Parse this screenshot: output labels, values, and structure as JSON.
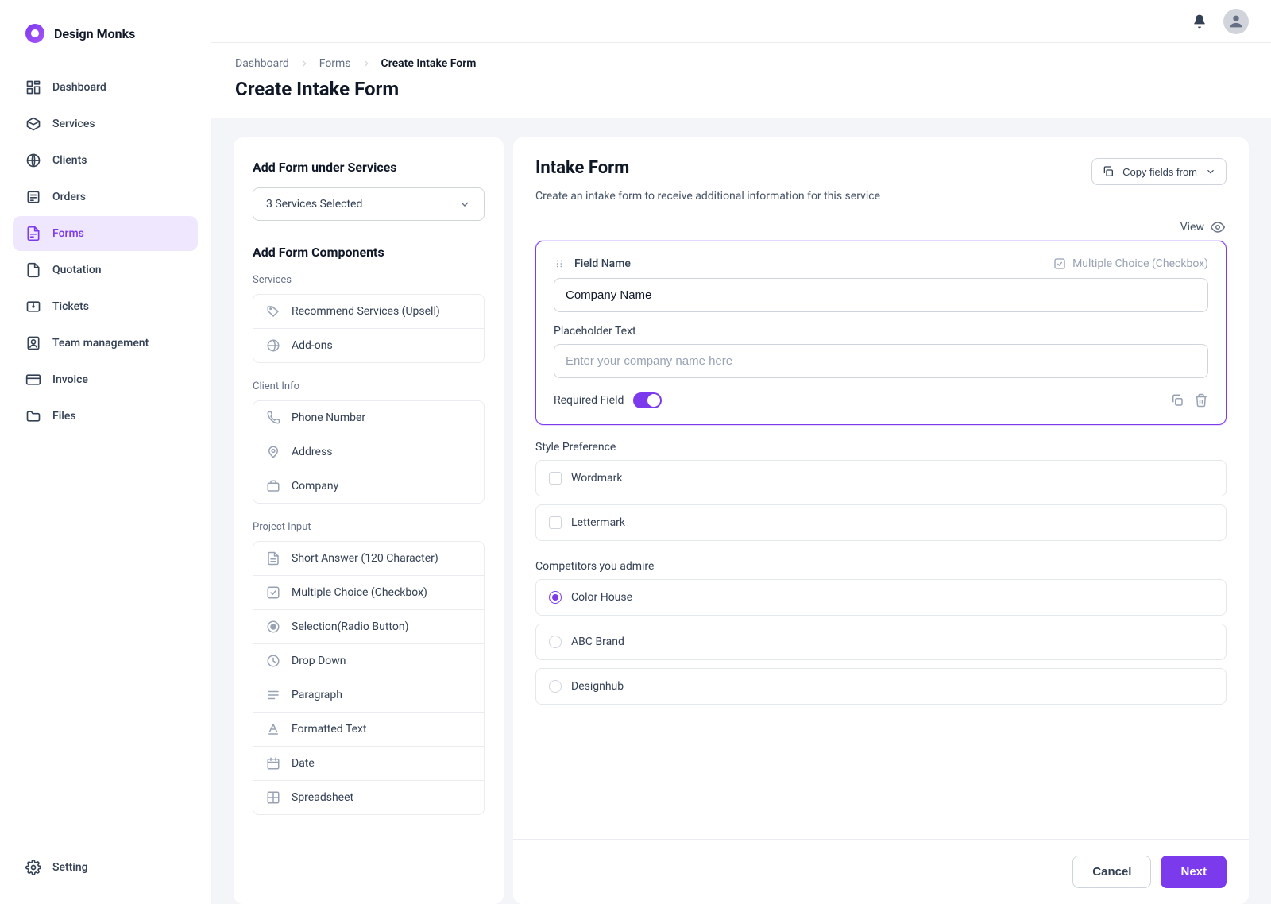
{
  "brand": {
    "name": "Design Monks"
  },
  "sidebar": {
    "items": [
      {
        "label": "Dashboard",
        "icon": "dashboard-icon"
      },
      {
        "label": "Services",
        "icon": "box-icon"
      },
      {
        "label": "Clients",
        "icon": "globe-icon"
      },
      {
        "label": "Orders",
        "icon": "list-icon"
      },
      {
        "label": "Forms",
        "icon": "form-icon",
        "active": true
      },
      {
        "label": "Quotation",
        "icon": "file-icon"
      },
      {
        "label": "Tickets",
        "icon": "ticket-icon"
      },
      {
        "label": "Team management",
        "icon": "user-badge-icon"
      },
      {
        "label": "Invoice",
        "icon": "card-icon"
      },
      {
        "label": "Files",
        "icon": "folder-icon"
      }
    ],
    "footer": {
      "label": "Setting",
      "icon": "gear-icon"
    }
  },
  "breadcrumb": {
    "items": [
      {
        "label": "Dashboard"
      },
      {
        "label": "Forms"
      },
      {
        "label": "Create Intake Form",
        "current": true
      }
    ]
  },
  "page": {
    "title": "Create Intake Form"
  },
  "left": {
    "heading": "Add Form under Services",
    "selectedServices": "3 Services Selected",
    "componentsHeading": "Add Form Components",
    "groups": [
      {
        "label": "Services",
        "items": [
          {
            "label": "Recommend Services (Upsell)",
            "icon": "tag-icon"
          },
          {
            "label": "Add-ons",
            "icon": "globe2-icon"
          }
        ]
      },
      {
        "label": "Client Info",
        "items": [
          {
            "label": "Phone Number",
            "icon": "phone-icon"
          },
          {
            "label": "Address",
            "icon": "pin-icon"
          },
          {
            "label": "Company",
            "icon": "briefcase-icon"
          }
        ]
      },
      {
        "label": "Project Input",
        "items": [
          {
            "label": "Short Answer (120 Character)",
            "icon": "file-text-icon"
          },
          {
            "label": "Multiple Choice (Checkbox)",
            "icon": "check-square-icon"
          },
          {
            "label": "Selection(Radio Button)",
            "icon": "radio-icon"
          },
          {
            "label": "Drop Down",
            "icon": "clock-icon"
          },
          {
            "label": "Paragraph",
            "icon": "paragraph-icon"
          },
          {
            "label": "Formatted Text",
            "icon": "format-text-icon"
          },
          {
            "label": "Date",
            "icon": "calendar-icon"
          },
          {
            "label": "Spreadsheet",
            "icon": "grid-icon"
          }
        ]
      }
    ]
  },
  "right": {
    "title": "Intake Form",
    "subtitle": "Create an intake form to receive additional information for this service",
    "copyButton": "Copy fields from",
    "viewLabel": "View",
    "activeField": {
      "fieldNameLabel": "Field Name",
      "fieldNameValue": "Company Name",
      "typeLabel": "Multiple Choice (Checkbox)",
      "placeholderLabel": "Placeholder Text",
      "placeholderValue": "Enter your company name here",
      "requiredLabel": "Required Field"
    },
    "fields": [
      {
        "label": "Style Preference",
        "type": "checkbox",
        "options": [
          "Wordmark",
          "Lettermark"
        ]
      },
      {
        "label": "Competitors you admire",
        "type": "radio",
        "selectedIndex": 0,
        "options": [
          "Color House",
          "ABC Brand",
          "Designhub"
        ]
      }
    ]
  },
  "buttons": {
    "cancel": "Cancel",
    "next": "Next"
  }
}
